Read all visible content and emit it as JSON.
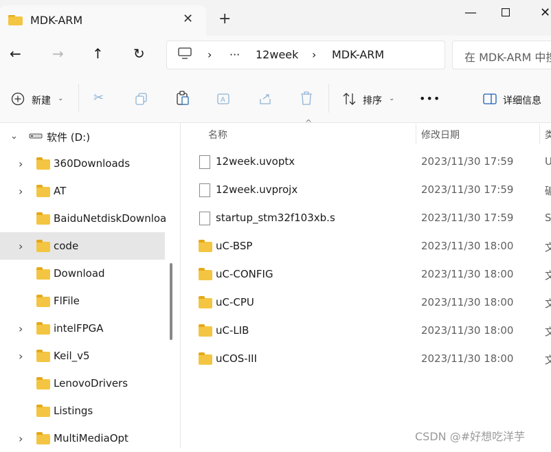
{
  "tab": {
    "title": "MDK-ARM"
  },
  "address": {
    "crumbs": [
      "12week",
      "MDK-ARM"
    ],
    "more": "···"
  },
  "search": {
    "placeholder": "在 MDK-ARM 中搜索"
  },
  "toolbar": {
    "new_label": "新建",
    "sort_label": "排序",
    "more_label": "•••",
    "details_label": "详细信息"
  },
  "nav": {
    "drive": "软件 (D:)",
    "items": [
      {
        "label": "360Downloads",
        "expandable": true
      },
      {
        "label": "AT",
        "expandable": true
      },
      {
        "label": "BaiduNetdiskDownload",
        "expandable": false
      },
      {
        "label": "code",
        "expandable": true,
        "selected": true
      },
      {
        "label": "Download",
        "expandable": false
      },
      {
        "label": "FlFile",
        "expandable": false
      },
      {
        "label": "intelFPGA",
        "expandable": true
      },
      {
        "label": "Keil_v5",
        "expandable": true
      },
      {
        "label": "LenovoDrivers",
        "expandable": false
      },
      {
        "label": "Listings",
        "expandable": false
      },
      {
        "label": "MultiMediaOpt",
        "expandable": true
      }
    ]
  },
  "files": {
    "headers": {
      "name": "名称",
      "date": "修改日期",
      "type": "类"
    },
    "rows": [
      {
        "name": "12week.uvoptx",
        "date": "2023/11/30 17:59",
        "type": "U",
        "kind": "file"
      },
      {
        "name": "12week.uvprojx",
        "date": "2023/11/30 17:59",
        "type": "礦",
        "kind": "file"
      },
      {
        "name": "startup_stm32f103xb.s",
        "date": "2023/11/30 17:59",
        "type": "S",
        "kind": "file"
      },
      {
        "name": "uC-BSP",
        "date": "2023/11/30 18:00",
        "type": "文",
        "kind": "folder"
      },
      {
        "name": "uC-CONFIG",
        "date": "2023/11/30 18:00",
        "type": "文",
        "kind": "folder"
      },
      {
        "name": "uC-CPU",
        "date": "2023/11/30 18:00",
        "type": "文",
        "kind": "folder"
      },
      {
        "name": "uC-LIB",
        "date": "2023/11/30 18:00",
        "type": "文",
        "kind": "folder"
      },
      {
        "name": "uCOS-III",
        "date": "2023/11/30 18:00",
        "type": "文",
        "kind": "folder"
      }
    ]
  },
  "watermark": "CSDN @#好想吃洋芋"
}
